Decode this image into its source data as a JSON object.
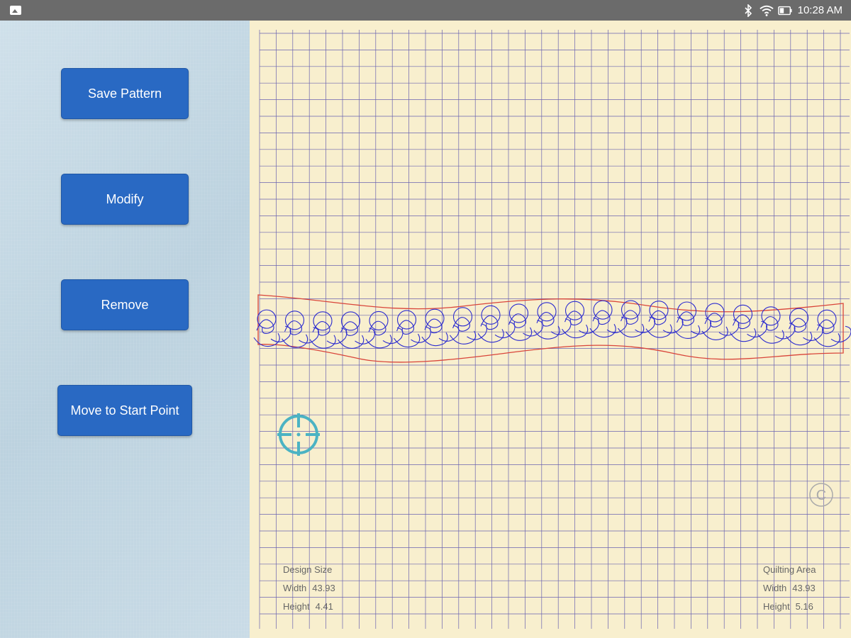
{
  "status_bar": {
    "time": "10:28 AM",
    "icons": [
      "image-notification-icon",
      "bluetooth-icon",
      "wifi-icon",
      "battery-icon"
    ]
  },
  "sidebar": {
    "buttons": {
      "save_pattern": "Save Pattern",
      "modify": "Modify",
      "remove": "Remove",
      "move_to_start": "Move to Start Point"
    }
  },
  "design_info": {
    "title": "Design Size",
    "width_label": "Width",
    "width_value": "43.93",
    "height_label": "Height",
    "height_value": "4.41"
  },
  "quilting_info": {
    "title": "Quilting Area",
    "width_label": "Width",
    "width_value": "43.93",
    "height_label": "Height",
    "height_value": "5.16"
  },
  "colors": {
    "button": "#2969c3",
    "canvas_bg": "#f8efce",
    "grid_line": "#5a5aa8",
    "pattern_stroke": "#2b2bd0",
    "boundary_stroke": "#d9453a",
    "crosshair": "#4bb3c3"
  }
}
